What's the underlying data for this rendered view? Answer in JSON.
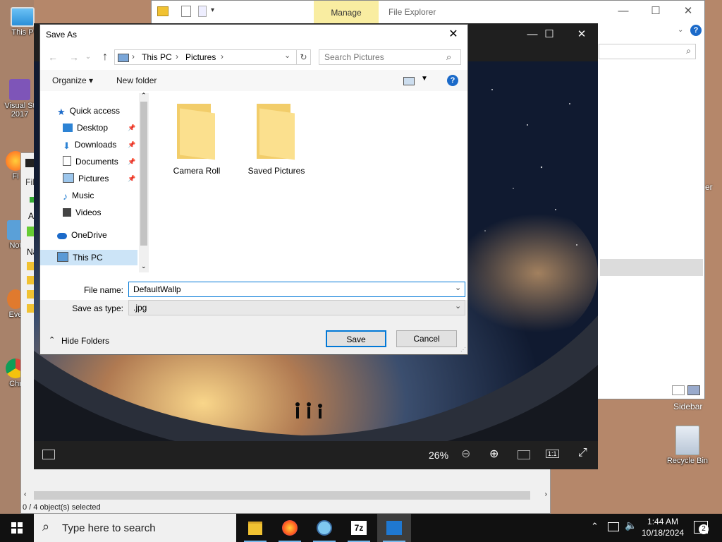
{
  "desktop": {
    "icons": [
      {
        "label": "This P",
        "name": "this-pc"
      },
      {
        "label": "Visual St 2017",
        "name": "visual-studio"
      },
      {
        "label": "Fi",
        "name": "firefox"
      },
      {
        "label": "Not",
        "name": "notepad"
      },
      {
        "label": "Eve",
        "name": "everything"
      },
      {
        "label": "Chr",
        "name": "chrome"
      }
    ],
    "recycle_bin_label": "Recycle Bin",
    "sidebar_label": "Sidebar",
    "er_label": "er"
  },
  "file_explorer": {
    "manage_tab": "Manage",
    "title": "File Explorer",
    "minimize": "—",
    "maximize": "☐",
    "close": "✕"
  },
  "background_app": {
    "status": "0 / 4 object(s) selected",
    "menu_initial": "Fil",
    "row_initial_a": "A",
    "col_header": "Na"
  },
  "photo_viewer": {
    "zoom": "26%",
    "minimize": "—",
    "maximize": "☐",
    "close": "✕",
    "actual_size": "1:1"
  },
  "save_dialog": {
    "title": "Save As",
    "breadcrumb": [
      "This PC",
      "Pictures"
    ],
    "search_placeholder": "Search Pictures",
    "organize": "Organize ▾",
    "new_folder": "New folder",
    "nav_tree": [
      {
        "label": "Quick access",
        "icon": "star-icon",
        "pinned": false
      },
      {
        "label": "Desktop",
        "icon": "desktop-icon",
        "pinned": true
      },
      {
        "label": "Downloads",
        "icon": "downloads-icon",
        "pinned": true
      },
      {
        "label": "Documents",
        "icon": "documents-icon",
        "pinned": true
      },
      {
        "label": "Pictures",
        "icon": "pictures-icon",
        "pinned": true
      },
      {
        "label": "Music",
        "icon": "music-icon",
        "pinned": false
      },
      {
        "label": "Videos",
        "icon": "videos-icon",
        "pinned": false
      },
      {
        "label": "OneDrive",
        "icon": "onedrive-icon",
        "pinned": false
      },
      {
        "label": "This PC",
        "icon": "this-pc-icon",
        "pinned": false,
        "selected": true
      }
    ],
    "folders": [
      "Camera Roll",
      "Saved Pictures"
    ],
    "file_name_label": "File name:",
    "file_name_value": "DefaultWallp",
    "save_as_type_label": "Save as type:",
    "save_as_type_value": ".jpg",
    "hide_folders": "Hide Folders",
    "save_button": "Save",
    "cancel_button": "Cancel"
  },
  "taskbar": {
    "search_placeholder": "Type here to search",
    "time": "1:44 AM",
    "date": "10/18/2024",
    "notification_count": "2",
    "pinned_apps": [
      "file-explorer",
      "firefox",
      "chrome",
      "7zip",
      "photos"
    ]
  },
  "colors": {
    "accent": "#0078d7",
    "folder_yellow": "#f8d775",
    "manage_tab_bg": "#f9eda1"
  }
}
